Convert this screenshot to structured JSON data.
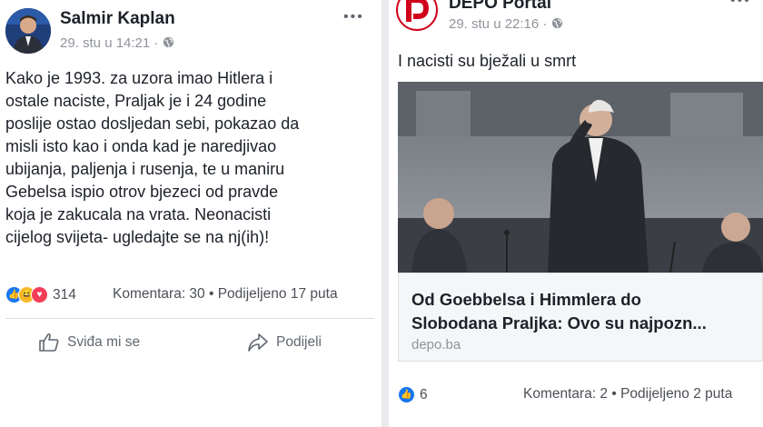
{
  "left_post": {
    "author": "Salmir Kaplan",
    "timestamp": "29. stu u 14:21 · ",
    "privacy_icon": "globe-icon",
    "more_icon": "more-options-icon",
    "body_lines": [
      "Kako je 1993. za uzora imao Hitlera i",
      "ostale naciste, Praljak je i 24 godine",
      "poslije ostao dosljedan sebi, pokazao da",
      "misli isto kao i onda kad je naredjivao",
      "ubijanja, paljenja i rusenja, te u maniru",
      "Gebelsa ispio otrov bjezeci od pravde",
      "koja je zakucala na vrata. Neonacisti",
      "cijelog svijeta- ugledajte se na nj(ih)!"
    ],
    "reaction_count": "314",
    "comments": "Komentara: 30 • Podijeljeno 17 puta",
    "like_label": "Sviđa mi se",
    "share_label": "Podijeli"
  },
  "right_post": {
    "author": "DEPO Portal",
    "timestamp": "29. stu u 22:16 · ",
    "privacy_icon": "globe-icon",
    "more_icon": "more-options-icon",
    "body": "I nacisti su bježali u smrt",
    "link_title_line1": "Od Goebbelsa i Himmlera do",
    "link_title_line2": "Slobodana Praljka: Ovo su najpozn...",
    "link_domain": "depo.ba",
    "reaction_count": "6",
    "comments": "Komentara: 2 • Podijeljeno 2 puta"
  },
  "colors": {
    "facebook_blue": "#1877f2",
    "haha_yellow": "#f7b928",
    "love_red": "#f33e58",
    "depo_red": "#d0021b",
    "meta_gray": "#90949c",
    "text": "#1d2129"
  }
}
